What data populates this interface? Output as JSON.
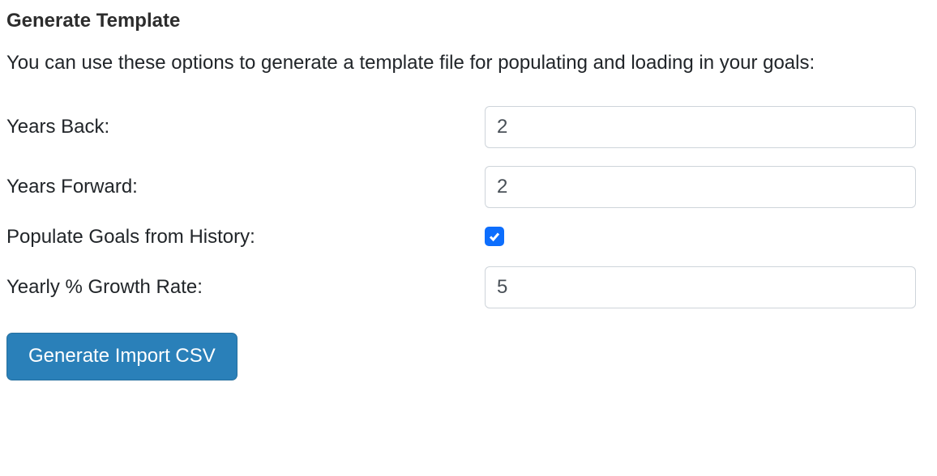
{
  "header": {
    "title": "Generate Template",
    "description": "You can use these options to generate a template file for populating and loading in your goals:"
  },
  "form": {
    "years_back": {
      "label": "Years Back:",
      "value": "2"
    },
    "years_forward": {
      "label": "Years Forward:",
      "value": "2"
    },
    "populate_history": {
      "label": "Populate Goals from History:",
      "checked": true
    },
    "growth_rate": {
      "label": "Yearly % Growth Rate:",
      "value": "5"
    }
  },
  "actions": {
    "generate_label": "Generate Import CSV"
  }
}
